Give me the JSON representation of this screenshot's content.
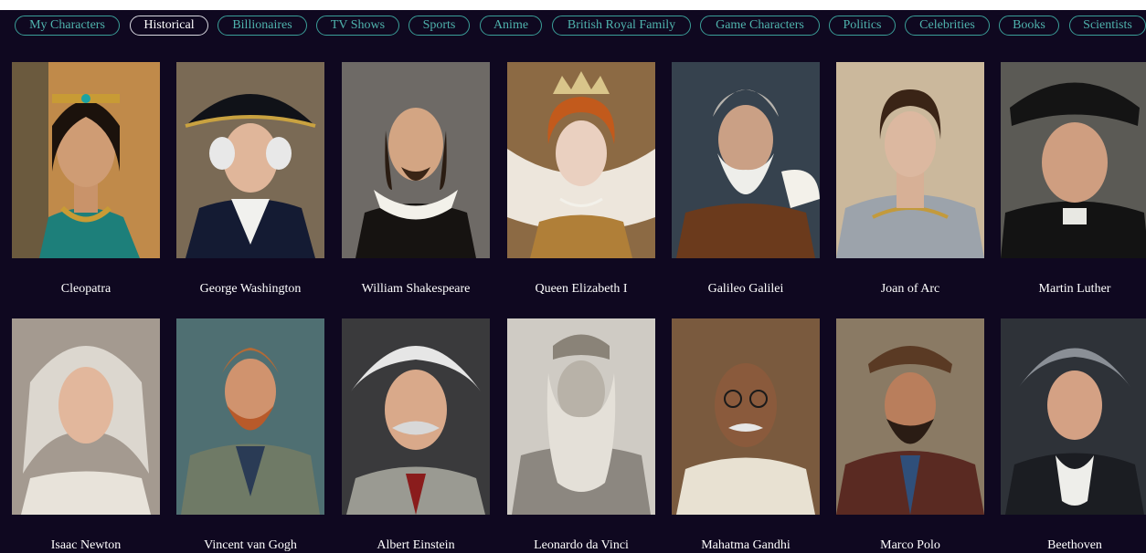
{
  "categories": [
    {
      "label": "My Characters",
      "active": false
    },
    {
      "label": "Historical",
      "active": true
    },
    {
      "label": "Billionaires",
      "active": false
    },
    {
      "label": "TV Shows",
      "active": false
    },
    {
      "label": "Sports",
      "active": false
    },
    {
      "label": "Anime",
      "active": false
    },
    {
      "label": "British Royal Family",
      "active": false
    },
    {
      "label": "Game Characters",
      "active": false
    },
    {
      "label": "Politics",
      "active": false
    },
    {
      "label": "Celebrities",
      "active": false
    },
    {
      "label": "Books",
      "active": false
    },
    {
      "label": "Scientists",
      "active": false
    }
  ],
  "characters": [
    {
      "name": "Cleopatra"
    },
    {
      "name": "George Washington"
    },
    {
      "name": "William Shakespeare"
    },
    {
      "name": "Queen Elizabeth I"
    },
    {
      "name": "Galileo Galilei"
    },
    {
      "name": "Joan of Arc"
    },
    {
      "name": "Martin Luther"
    },
    {
      "name": "Isaac Newton"
    },
    {
      "name": "Vincent van Gogh"
    },
    {
      "name": "Albert Einstein"
    },
    {
      "name": "Leonardo da Vinci"
    },
    {
      "name": "Mahatma Gandhi"
    },
    {
      "name": "Marco Polo"
    },
    {
      "name": "Beethoven"
    }
  ],
  "colors": {
    "background": "#0f0820",
    "tab_accent": "#4fb3ad",
    "tab_active": "#ffffff",
    "name_text": "#ffffff"
  }
}
